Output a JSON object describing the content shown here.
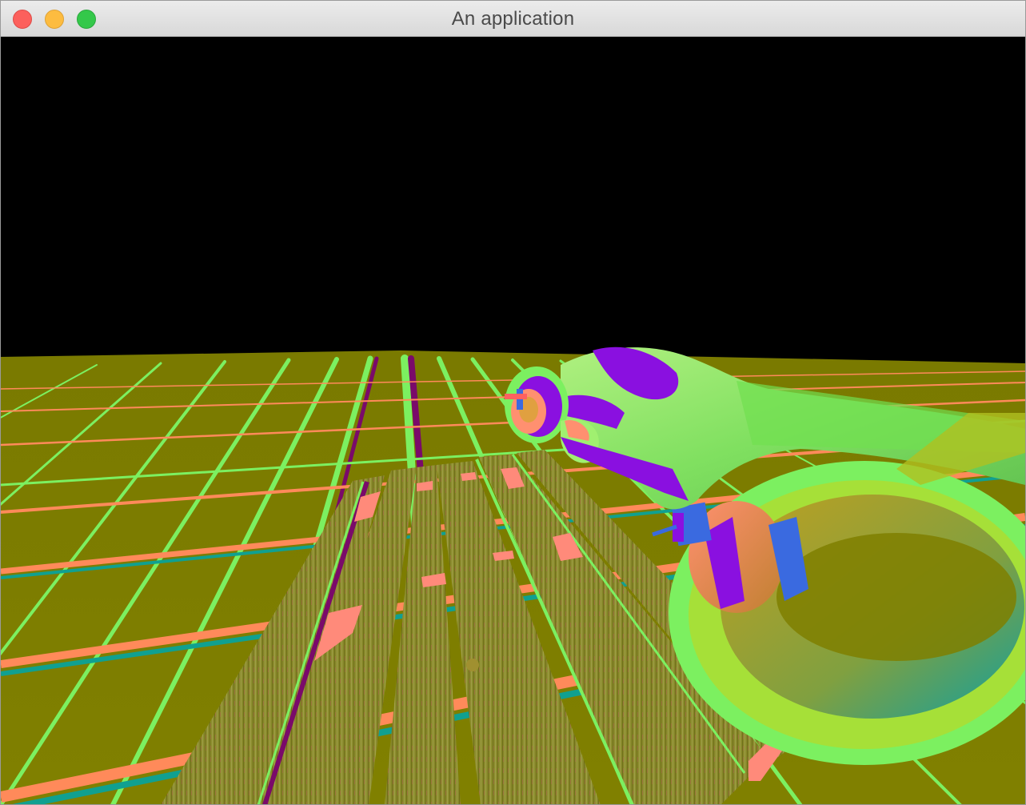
{
  "window": {
    "title": "An application",
    "controls": {
      "close": "close-button",
      "minimize": "minimize-button",
      "zoom": "zoom-button"
    }
  },
  "scene": {
    "description_type": "3d-normal-map-render",
    "colors": {
      "sky": "#000000",
      "ground": "#7f7f00",
      "grid_green": "#7cf060",
      "grid_purple": "#7a0a6a",
      "grid_salmon": "#ff8a5a",
      "wood": "#8a8a2a",
      "bike_green": "#8cf070",
      "bike_purple": "#8a10e0",
      "bike_blue": "#3a6ae0",
      "bike_salmon": "#ff8070",
      "bike_teal": "#10a0a0"
    }
  }
}
